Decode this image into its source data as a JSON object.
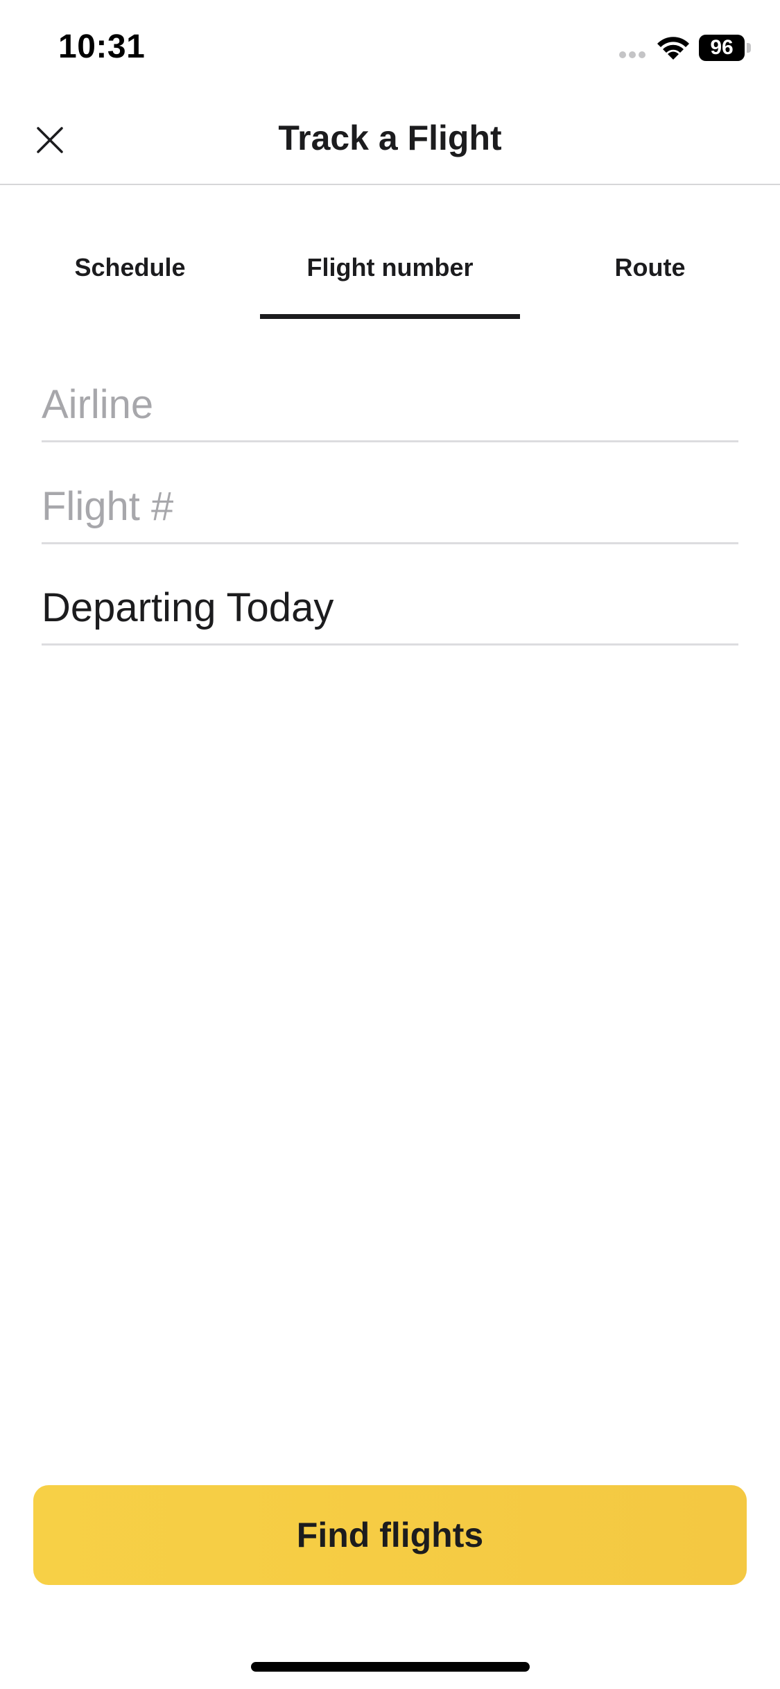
{
  "status_bar": {
    "time": "10:31",
    "battery": "96"
  },
  "header": {
    "title": "Track a Flight",
    "close_icon": "close-icon"
  },
  "tabs": [
    {
      "label": "Schedule",
      "active": false
    },
    {
      "label": "Flight number",
      "active": true
    },
    {
      "label": "Route",
      "active": false
    }
  ],
  "form": {
    "airline": {
      "placeholder": "Airline",
      "value": ""
    },
    "flight_number": {
      "placeholder": "Flight #",
      "value": ""
    },
    "departure": {
      "value": "Departing Today"
    }
  },
  "actions": {
    "find_label": "Find flights"
  },
  "colors": {
    "accent": "#f6cc44",
    "text": "#1c1c1e",
    "placeholder": "#a7a7ab",
    "divider": "#dcdcdf"
  }
}
